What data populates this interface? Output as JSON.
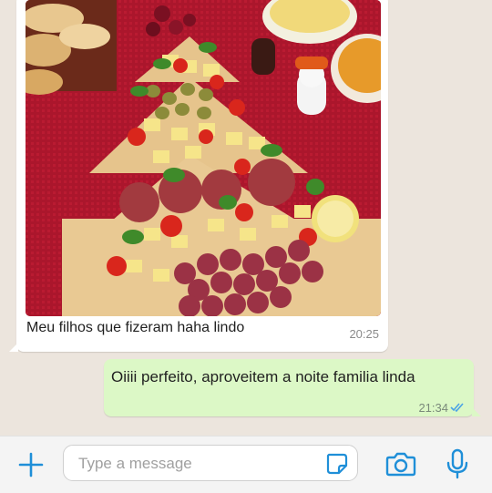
{
  "messages": {
    "incoming": {
      "caption": "Meu filhos que fizeram haha lindo",
      "time": "20:25",
      "photo_icon": "photo-charcuterie-christmas-tree"
    },
    "outgoing": {
      "text": "Oiiii perfeito, aproveitem a noite familia linda",
      "time": "21:34",
      "status": "read-double-check-icon"
    }
  },
  "composer": {
    "placeholder": "Type a message",
    "attach_icon": "plus-icon",
    "sticker_icon": "sticker-icon",
    "camera_icon": "camera-icon",
    "mic_icon": "mic-icon"
  },
  "colors": {
    "chat_bg": "#ece5dd",
    "incoming_bubble": "#ffffff",
    "outgoing_bubble": "#dcf8c6",
    "accent": "#1f8fd8",
    "read_ticks": "#4aa3e6"
  }
}
